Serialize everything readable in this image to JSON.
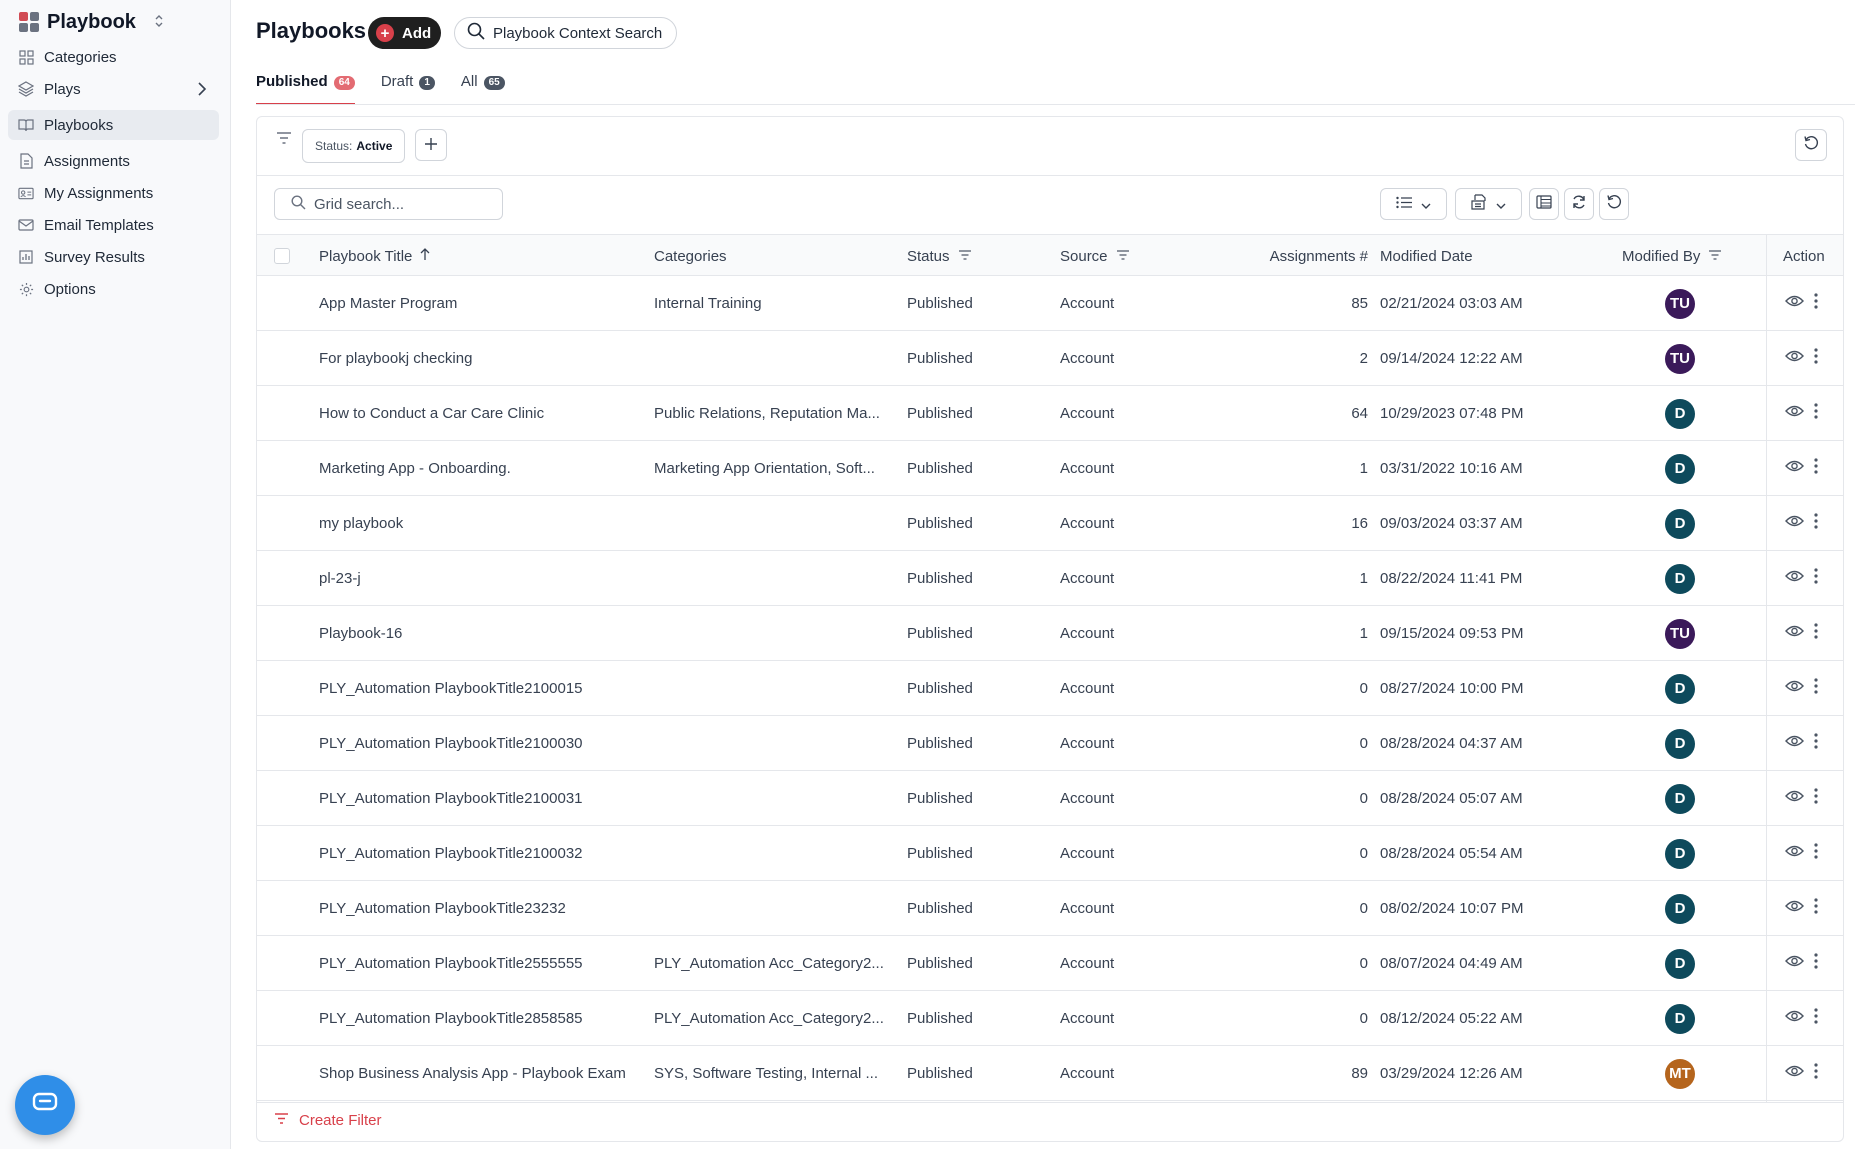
{
  "app": {
    "name": "Playbook"
  },
  "sidebar": {
    "items": [
      {
        "label": "Categories",
        "icon": "grid-icon"
      },
      {
        "label": "Plays",
        "icon": "layers-icon"
      },
      {
        "label": "Playbooks",
        "icon": "book-icon",
        "active": true
      },
      {
        "label": "Assignments",
        "icon": "document-icon"
      },
      {
        "label": "My Assignments",
        "icon": "id-card-icon"
      },
      {
        "label": "Email Templates",
        "icon": "mail-icon"
      },
      {
        "label": "Survey Results",
        "icon": "chart-icon"
      },
      {
        "label": "Options",
        "icon": "gear-icon"
      }
    ]
  },
  "header": {
    "title": "Playbooks",
    "add_label": "Add",
    "context_search_label": "Playbook Context Search"
  },
  "tabs": [
    {
      "label": "Published",
      "count": "64",
      "active": true
    },
    {
      "label": "Draft",
      "count": "1"
    },
    {
      "label": "All",
      "count": "65"
    }
  ],
  "filters": {
    "status_label": "Status:",
    "status_value": "Active",
    "create_filter_label": "Create Filter"
  },
  "grid": {
    "search_placeholder": "Grid search...",
    "columns": {
      "title": "Playbook Title",
      "categories": "Categories",
      "status": "Status",
      "source": "Source",
      "assignments": "Assignments #",
      "modified_date": "Modified Date",
      "modified_by": "Modified By",
      "action": "Action"
    },
    "rows": [
      {
        "title": "App Master Program",
        "categories": "Internal Training",
        "status": "Published",
        "source": "Account",
        "assignments": "85",
        "modified_date": "02/21/2024 03:03 AM",
        "modified_by": "TU",
        "avatar_color": "#3b1a5a"
      },
      {
        "title": "For playbookj checking",
        "categories": "",
        "status": "Published",
        "source": "Account",
        "assignments": "2",
        "modified_date": "09/14/2024 12:22 AM",
        "modified_by": "TU",
        "avatar_color": "#3b1a5a"
      },
      {
        "title": "How to Conduct a Car Care Clinic",
        "categories": "Public Relations, Reputation Ma...",
        "status": "Published",
        "source": "Account",
        "assignments": "64",
        "modified_date": "10/29/2023 07:48 PM",
        "modified_by": "D",
        "avatar_color": "#0e4a5c"
      },
      {
        "title": "Marketing App - Onboarding.",
        "categories": "Marketing App Orientation, Soft...",
        "status": "Published",
        "source": "Account",
        "assignments": "1",
        "modified_date": "03/31/2022 10:16 AM",
        "modified_by": "D",
        "avatar_color": "#0e4a5c"
      },
      {
        "title": "my playbook",
        "categories": "",
        "status": "Published",
        "source": "Account",
        "assignments": "16",
        "modified_date": "09/03/2024 03:37 AM",
        "modified_by": "D",
        "avatar_color": "#0e4a5c"
      },
      {
        "title": "pl-23-j",
        "categories": "",
        "status": "Published",
        "source": "Account",
        "assignments": "1",
        "modified_date": "08/22/2024 11:41 PM",
        "modified_by": "D",
        "avatar_color": "#0e4a5c"
      },
      {
        "title": "Playbook-16",
        "categories": "",
        "status": "Published",
        "source": "Account",
        "assignments": "1",
        "modified_date": "09/15/2024 09:53 PM",
        "modified_by": "TU",
        "avatar_color": "#3b1a5a"
      },
      {
        "title": "PLY_Automation PlaybookTitle2100015",
        "categories": "",
        "status": "Published",
        "source": "Account",
        "assignments": "0",
        "modified_date": "08/27/2024 10:00 PM",
        "modified_by": "D",
        "avatar_color": "#0e4a5c"
      },
      {
        "title": "PLY_Automation PlaybookTitle2100030",
        "categories": "",
        "status": "Published",
        "source": "Account",
        "assignments": "0",
        "modified_date": "08/28/2024 04:37 AM",
        "modified_by": "D",
        "avatar_color": "#0e4a5c"
      },
      {
        "title": "PLY_Automation PlaybookTitle2100031",
        "categories": "",
        "status": "Published",
        "source": "Account",
        "assignments": "0",
        "modified_date": "08/28/2024 05:07 AM",
        "modified_by": "D",
        "avatar_color": "#0e4a5c"
      },
      {
        "title": "PLY_Automation PlaybookTitle2100032",
        "categories": "",
        "status": "Published",
        "source": "Account",
        "assignments": "0",
        "modified_date": "08/28/2024 05:54 AM",
        "modified_by": "D",
        "avatar_color": "#0e4a5c"
      },
      {
        "title": "PLY_Automation PlaybookTitle23232",
        "categories": "",
        "status": "Published",
        "source": "Account",
        "assignments": "0",
        "modified_date": "08/02/2024 10:07 PM",
        "modified_by": "D",
        "avatar_color": "#0e4a5c"
      },
      {
        "title": "PLY_Automation PlaybookTitle2555555",
        "categories": "PLY_Automation Acc_Category2...",
        "status": "Published",
        "source": "Account",
        "assignments": "0",
        "modified_date": "08/07/2024 04:49 AM",
        "modified_by": "D",
        "avatar_color": "#0e4a5c"
      },
      {
        "title": "PLY_Automation PlaybookTitle2858585",
        "categories": "PLY_Automation Acc_Category2...",
        "status": "Published",
        "source": "Account",
        "assignments": "0",
        "modified_date": "08/12/2024 05:22 AM",
        "modified_by": "D",
        "avatar_color": "#0e4a5c"
      },
      {
        "title": "Shop Business Analysis App - Playbook Exam",
        "categories": "SYS, Software Testing, Internal ...",
        "status": "Published",
        "source": "Account",
        "assignments": "89",
        "modified_date": "03/29/2024 12:26 AM",
        "modified_by": "MT",
        "avatar_color": "#b5651d"
      }
    ]
  },
  "colors": {
    "accent": "#d8404a",
    "fab": "#2f8ee8"
  }
}
